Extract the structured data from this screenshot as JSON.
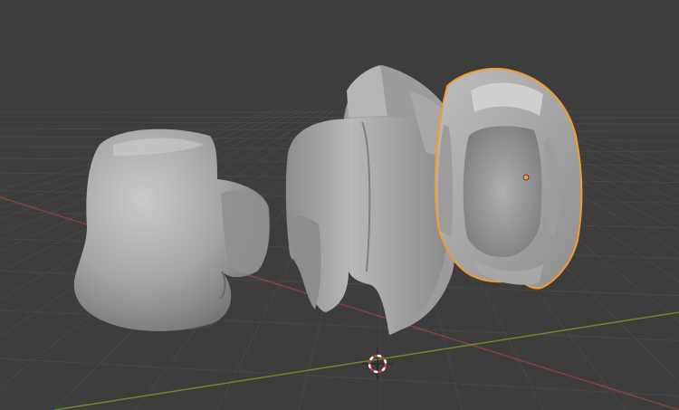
{
  "viewport": {
    "background_color": "#3d3d3d",
    "grid_color": "#4a4a4a",
    "x_axis_color": "#8a4141",
    "y_axis_color": "#6a8a2e",
    "mesh_color": "#a9a9a9",
    "selection_outline_color": "#f29b30",
    "origin_color": "#f29b30"
  },
  "scene": {
    "objects": [
      {
        "role": "helmet-face-part",
        "selected": false
      },
      {
        "role": "helmet-middle-part",
        "selected": false
      },
      {
        "role": "helmet-back-part",
        "selected": true
      }
    ],
    "cursor": {
      "icon": "3d-cursor-icon",
      "colors": [
        "#d23c3c",
        "#ffffff"
      ]
    }
  }
}
